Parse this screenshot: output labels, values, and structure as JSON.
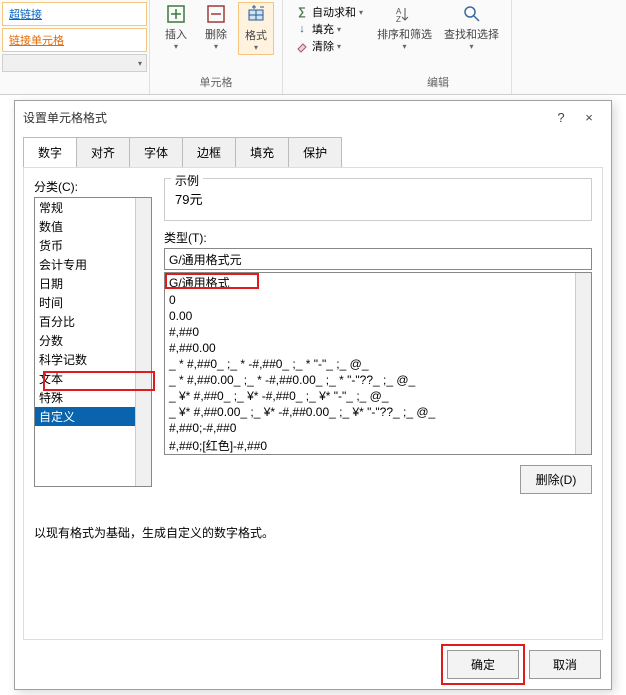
{
  "ribbon": {
    "styles": {
      "hyperlink": "超链接",
      "linked_cell": "链接单元格"
    },
    "cells": {
      "insert": "插入",
      "delete": "删除",
      "format": "格式",
      "group_label": "单元格"
    },
    "edit": {
      "autosum": "自动求和",
      "fill": "填充",
      "clear": "清除",
      "sort_filter": "排序和筛选",
      "find_select": "查找和选择",
      "group_label": "编辑"
    }
  },
  "dialog": {
    "title": "设置单元格格式",
    "tabs": [
      "数字",
      "对齐",
      "字体",
      "边框",
      "填充",
      "保护"
    ],
    "category_label": "分类(C):",
    "categories": [
      "常规",
      "数值",
      "货币",
      "会计专用",
      "日期",
      "时间",
      "百分比",
      "分数",
      "科学记数",
      "文本",
      "特殊",
      "自定义"
    ],
    "selected_category_index": 11,
    "sample_label": "示例",
    "sample_value": "79元",
    "type_label": "类型(T):",
    "type_value": "G/通用格式元",
    "type_list": [
      "G/通用格式",
      "0",
      "0.00",
      "#,##0",
      "#,##0.00",
      "_ * #,##0_ ;_ * -#,##0_ ;_ * \"-\"_ ;_ @_ ",
      "_ * #,##0.00_ ;_ * -#,##0.00_ ;_ * \"-\"??_ ;_ @_ ",
      "_ ¥* #,##0_ ;_ ¥* -#,##0_ ;_ ¥* \"-\"_ ;_ @_ ",
      "_ ¥* #,##0.00_ ;_ ¥* -#,##0.00_ ;_ ¥* \"-\"??_ ;_ @_ ",
      "#,##0;-#,##0",
      "#,##0;[红色]-#,##0"
    ],
    "delete_btn": "删除(D)",
    "note": "以现有格式为基础，生成自定义的数字格式。",
    "ok": "确定",
    "cancel": "取消",
    "help": "?",
    "close": "×"
  }
}
